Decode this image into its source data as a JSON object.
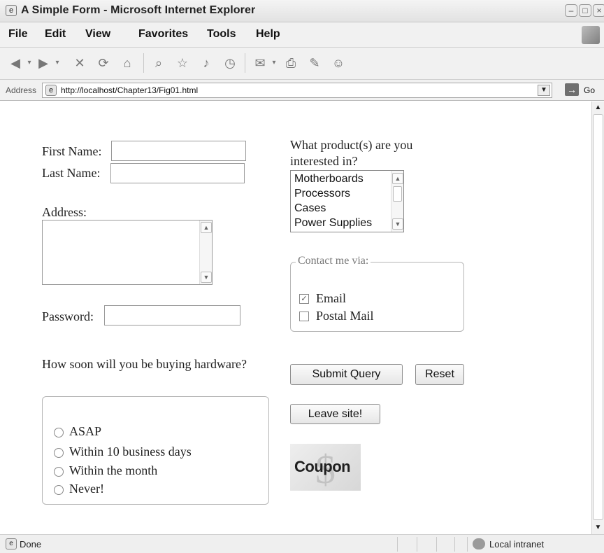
{
  "window": {
    "title": "A Simple Form - Microsoft Internet Explorer",
    "title_icon": "ie-page-icon"
  },
  "menu": [
    "File",
    "Edit",
    "View",
    "Favorites",
    "Tools",
    "Help"
  ],
  "address_bar": {
    "label": "Address",
    "url": "http://localhost/Chapter13/Fig01.html",
    "go_label": "Go"
  },
  "status_bar": {
    "text": "Done",
    "zone": "Local intranet"
  },
  "form": {
    "first_name_label": "First Name:",
    "first_name_value": "",
    "last_name_label": "Last Name:",
    "last_name_value": "",
    "address_label": "Address:",
    "address_value": "",
    "password_label": "Password:",
    "password_value": "",
    "hardware_question": "How soon will you be buying hardware?",
    "hardware_options": [
      "ASAP",
      "Within 10 business days",
      "Within the month",
      "Never!"
    ],
    "product_question": "What product(s) are you interested in?",
    "product_options": [
      "Motherboards",
      "Processors",
      "Cases",
      "Power Supplies"
    ],
    "contact_legend": "Contact me via:",
    "contact_options": [
      {
        "label": "Email",
        "checked": true
      },
      {
        "label": "Postal Mail",
        "checked": false
      }
    ],
    "submit_label": "Submit Query",
    "reset_label": "Reset",
    "leave_label": "Leave site!",
    "coupon_label": "Coupon"
  }
}
